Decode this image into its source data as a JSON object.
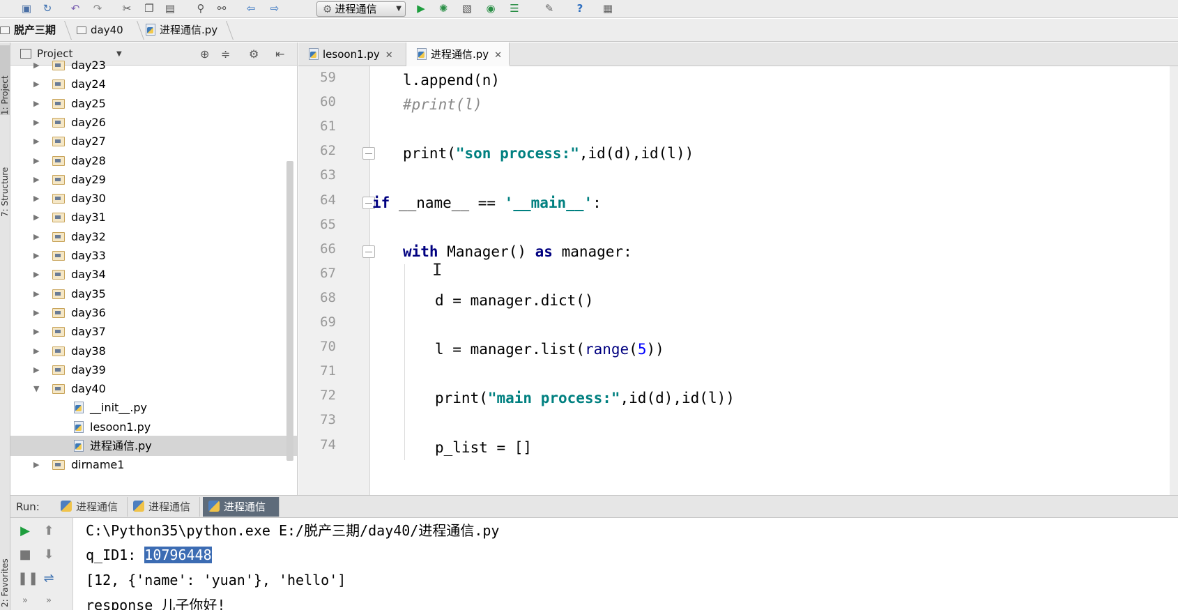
{
  "toolbar": {
    "run_config": "进程通信",
    "icons": [
      "save-icon",
      "sync-icon",
      "undo-icon",
      "redo-icon",
      "cut-icon",
      "copy-icon",
      "paste-icon",
      "find-icon",
      "replace-icon",
      "back-icon",
      "forward-icon",
      "run-icon",
      "debug-icon",
      "coverage-icon",
      "profile-icon",
      "run-concurrency-icon",
      "settings-icon",
      "help-icon",
      "vcs-icon"
    ]
  },
  "breadcrumb": [
    "脱产三期",
    "day40",
    "进程通信.py"
  ],
  "sidebar_tabs": {
    "project": "1: Project",
    "structure": "7: Structure",
    "favorites": "2: Favorites"
  },
  "project_panel": {
    "title": "Project",
    "tree": [
      {
        "label": "day23",
        "type": "dir",
        "open": false
      },
      {
        "label": "day24",
        "type": "dir",
        "open": false
      },
      {
        "label": "day25",
        "type": "dir",
        "open": false
      },
      {
        "label": "day26",
        "type": "dir",
        "open": false
      },
      {
        "label": "day27",
        "type": "dir",
        "open": false
      },
      {
        "label": "day28",
        "type": "dir",
        "open": false
      },
      {
        "label": "day29",
        "type": "dir",
        "open": false
      },
      {
        "label": "day30",
        "type": "dir",
        "open": false
      },
      {
        "label": "day31",
        "type": "dir",
        "open": false
      },
      {
        "label": "day32",
        "type": "dir",
        "open": false
      },
      {
        "label": "day33",
        "type": "dir",
        "open": false
      },
      {
        "label": "day34",
        "type": "dir",
        "open": false
      },
      {
        "label": "day35",
        "type": "dir",
        "open": false
      },
      {
        "label": "day36",
        "type": "dir",
        "open": false
      },
      {
        "label": "day37",
        "type": "dir",
        "open": false
      },
      {
        "label": "day38",
        "type": "dir",
        "open": false
      },
      {
        "label": "day39",
        "type": "dir",
        "open": false
      },
      {
        "label": "day40",
        "type": "dir",
        "open": true
      },
      {
        "label": "__init__.py",
        "type": "file"
      },
      {
        "label": "lesoon1.py",
        "type": "file"
      },
      {
        "label": "进程通信.py",
        "type": "file",
        "selected": true
      },
      {
        "label": "dirname1",
        "type": "dir",
        "open": false
      }
    ]
  },
  "editor": {
    "tabs": [
      {
        "label": "lesoon1.py",
        "active": false
      },
      {
        "label": "进程通信.py",
        "active": true
      }
    ],
    "lines": [
      {
        "n": "59",
        "indent": 1,
        "html": "l.append(n)"
      },
      {
        "n": "60",
        "indent": 1,
        "html": "<span class=\"cmt\">#print(l)</span>"
      },
      {
        "n": "61",
        "indent": 0,
        "html": ""
      },
      {
        "n": "62",
        "indent": 1,
        "html": "print(<span class=\"str\">\"son process:\"</span>,id(d),id(l))",
        "fold": true
      },
      {
        "n": "63",
        "indent": 0,
        "html": ""
      },
      {
        "n": "64",
        "indent": 0,
        "html": "<span class=\"kw\">if</span> __name__ == <span class=\"str\">'__main__'</span>:",
        "fold": true
      },
      {
        "n": "65",
        "indent": 0,
        "html": ""
      },
      {
        "n": "66",
        "indent": 1,
        "html": "<span class=\"kw\">with</span> Manager() <span class=\"kw\">as</span> manager:",
        "fold": true
      },
      {
        "n": "67",
        "indent": 0,
        "html": ""
      },
      {
        "n": "68",
        "indent": 2,
        "html": "d = manager.dict()"
      },
      {
        "n": "69",
        "indent": 0,
        "html": ""
      },
      {
        "n": "70",
        "indent": 2,
        "html": "l = manager.list(<span class=\"fn\">range</span>(<span class=\"num\">5</span>))"
      },
      {
        "n": "71",
        "indent": 0,
        "html": ""
      },
      {
        "n": "72",
        "indent": 2,
        "html": "print(<span class=\"str\">\"main process:\"</span>,id(d),id(l))"
      },
      {
        "n": "73",
        "indent": 0,
        "html": ""
      },
      {
        "n": "74",
        "indent": 2,
        "html": "p_list = []"
      }
    ]
  },
  "run_panel": {
    "label": "Run:",
    "tabs": [
      {
        "label": "进程通信",
        "active": false
      },
      {
        "label": "进程通信",
        "active": false
      },
      {
        "label": "进程通信",
        "active": true
      }
    ],
    "console": {
      "cmd": "C:\\Python35\\python.exe E:/脱产三期/day40/进程通信.py",
      "qid_label": "q_ID1: ",
      "qid_value": "10796448",
      "list_out": "[12, {'name': 'yuan'}, 'hello']",
      "partial": "response 儿子你好!"
    }
  }
}
